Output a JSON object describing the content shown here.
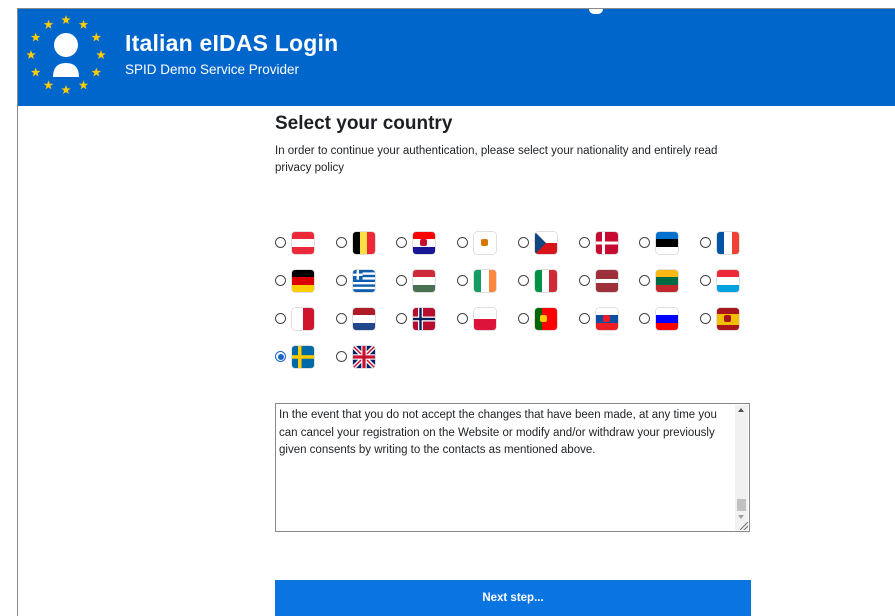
{
  "header": {
    "title": "Italian eIDAS Login",
    "subtitle": "SPID Demo Service Provider",
    "brand_color": "#0066cc",
    "logo_icon": "eu-stars-user-icon"
  },
  "main": {
    "heading": "Select your country",
    "intro": "In order to continue your authentication, please select your nationality and entirely read privacy policy"
  },
  "countries": [
    {
      "code": "AT",
      "selected": false
    },
    {
      "code": "BE",
      "selected": false
    },
    {
      "code": "HR",
      "selected": false
    },
    {
      "code": "CY",
      "selected": false
    },
    {
      "code": "CZ",
      "selected": false
    },
    {
      "code": "DK",
      "selected": false
    },
    {
      "code": "EE",
      "selected": false
    },
    {
      "code": "FR",
      "selected": false
    },
    {
      "code": "DE",
      "selected": false
    },
    {
      "code": "GR",
      "selected": false
    },
    {
      "code": "HU",
      "selected": false
    },
    {
      "code": "IE",
      "selected": false
    },
    {
      "code": "IT",
      "selected": false
    },
    {
      "code": "LV",
      "selected": false
    },
    {
      "code": "LT",
      "selected": false
    },
    {
      "code": "LU",
      "selected": false
    },
    {
      "code": "MT",
      "selected": false
    },
    {
      "code": "NL",
      "selected": false
    },
    {
      "code": "NO",
      "selected": false
    },
    {
      "code": "PL",
      "selected": false
    },
    {
      "code": "PT",
      "selected": false
    },
    {
      "code": "SK",
      "selected": false
    },
    {
      "code": "SI",
      "selected": false
    },
    {
      "code": "ES",
      "selected": false
    },
    {
      "code": "SE",
      "selected": true
    },
    {
      "code": "GB",
      "selected": false
    }
  ],
  "policy": {
    "text": "In the event that you do not accept the changes that have been made, at any time you can cancel your registration on the Website or modify and/or withdraw your previously given consents by writing to the contacts as mentioned above."
  },
  "next_button": {
    "label": "Next step...",
    "color": "#0a74e0"
  }
}
